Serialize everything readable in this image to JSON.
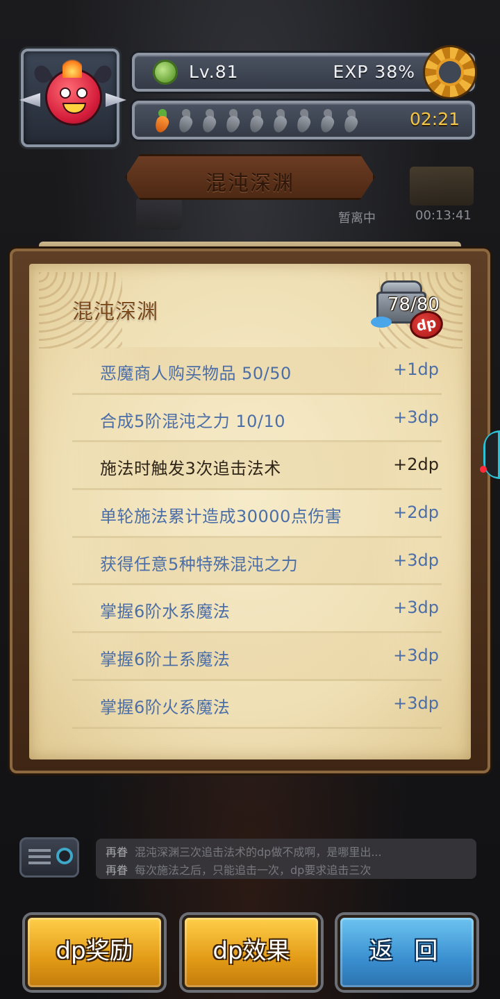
{
  "hud": {
    "level": "Lv.81",
    "exp": "EXP 38%",
    "stamina_timer": "02:21",
    "stamina_icons": [
      "carrot-full",
      "carrot-empty",
      "carrot-empty",
      "carrot-empty",
      "carrot-empty",
      "carrot-empty",
      "carrot-empty",
      "carrot-empty",
      "carrot-empty"
    ]
  },
  "banner": {
    "title": "混沌深渊",
    "away_status": "暂离中",
    "away_timer": "00:13:41"
  },
  "panel": {
    "title": "混沌深渊",
    "chest_count": "78/80",
    "dp_badge": "dp",
    "tasks": [
      {
        "name": "恶魔商人购买物品 50/50",
        "reward": "+1dp",
        "status": "claimable"
      },
      {
        "name": "合成5阶混沌之力 10/10",
        "reward": "+3dp",
        "status": "claimable"
      },
      {
        "name": "施法时触发3次追击法术",
        "reward": "+2dp",
        "status": "incomplete"
      },
      {
        "name": "单轮施法累计造成30000点伤害",
        "reward": "+2dp",
        "status": "claimable"
      },
      {
        "name": "获得任意5种特殊混沌之力",
        "reward": "+3dp",
        "status": "claimable"
      },
      {
        "name": "掌握6阶水系魔法",
        "reward": "+3dp",
        "status": "claimable"
      },
      {
        "name": "掌握6阶土系魔法",
        "reward": "+3dp",
        "status": "claimable"
      },
      {
        "name": "掌握6阶火系魔法",
        "reward": "+3dp",
        "status": "claimable"
      }
    ]
  },
  "chat": {
    "messages": [
      {
        "user": "再眷",
        "text": "混沌深渊三次追击法术的dp做不成啊，是哪里出..."
      },
      {
        "user": "再眷",
        "text": "每次施法之后，只能追击一次，dp要求追击三次"
      }
    ]
  },
  "buttons": {
    "dp_reward": "dp奖励",
    "dp_effect": "dp效果",
    "back": "返 回"
  },
  "colors": {
    "task_claimable": "#4c6ea7",
    "task_incomplete": "#2e2518",
    "timer": "#f2c64a",
    "button_gold": "#e29a16",
    "button_blue": "#3a8fd0"
  }
}
